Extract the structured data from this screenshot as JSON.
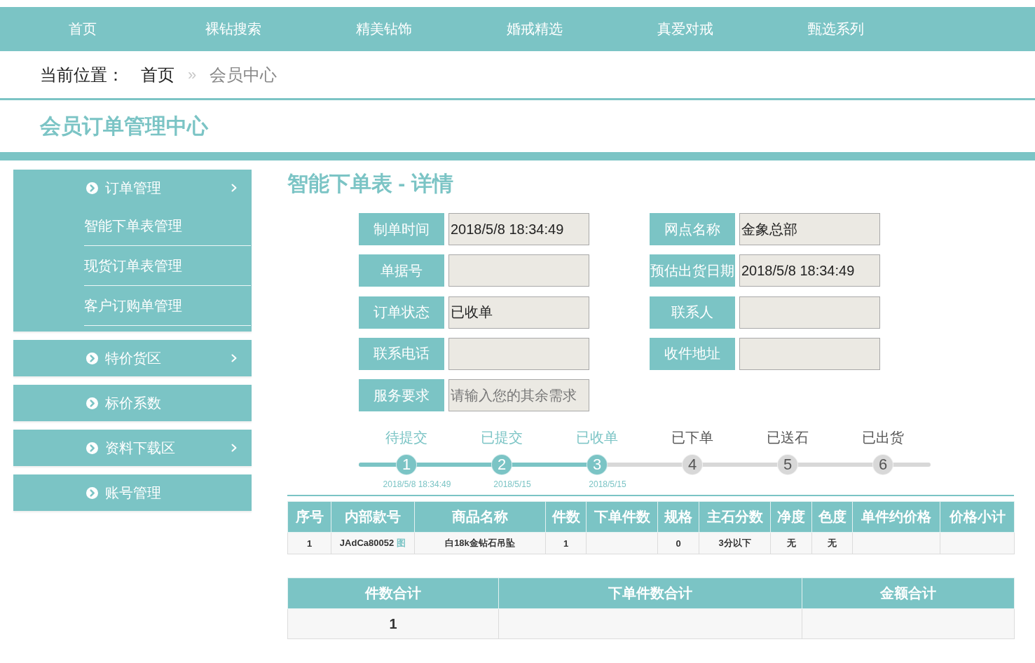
{
  "nav": {
    "items": [
      "首页",
      "裸钻搜索",
      "精美钻饰",
      "婚戒精选",
      "真爱对戒",
      "甄选系列"
    ]
  },
  "breadcrumb": {
    "prefix": "当前位置：",
    "separator": "»",
    "items": [
      {
        "label": "首页",
        "current": false
      },
      {
        "label": "会员中心",
        "current": true
      }
    ]
  },
  "page_title": "会员订单管理中心",
  "sidebar": {
    "groups": [
      {
        "label": "订单管理",
        "has_submenu": true,
        "children": [
          {
            "label": "智能下单表管理"
          },
          {
            "label": "现货订单表管理"
          },
          {
            "label": "客户订购单管理"
          }
        ]
      },
      {
        "label": "特价货区",
        "has_submenu": true
      },
      {
        "label": "标价系数",
        "has_submenu": false
      },
      {
        "label": "资料下载区",
        "has_submenu": true
      },
      {
        "label": "账号管理",
        "has_submenu": false
      }
    ]
  },
  "detail": {
    "title": "智能下单表 - 详情",
    "fields": [
      {
        "label": "制单时间",
        "value": "2018/5/8 18:34:49"
      },
      {
        "label": "网点名称",
        "value": "金象总部"
      },
      {
        "label": "单据号"
      },
      {
        "label": "预估出货日期",
        "value": "2018/5/8 18:34:49"
      },
      {
        "label": "订单状态",
        "value": "已收单"
      },
      {
        "label": "联系人"
      },
      {
        "label": "联系电话"
      },
      {
        "label": "收件地址"
      },
      {
        "label": "服务要求",
        "placeholder": "请输入您的其余需求"
      }
    ]
  },
  "progress": {
    "steps": [
      {
        "label": "待提交",
        "number": "1",
        "done": true,
        "date": "2018/5/8 18:34:49"
      },
      {
        "label": "已提交",
        "number": "2",
        "done": true,
        "date": "2018/5/15"
      },
      {
        "label": "已收单",
        "number": "3",
        "done": true,
        "date": "2018/5/15"
      },
      {
        "label": "已下单",
        "number": "4",
        "done": false
      },
      {
        "label": "已送石",
        "number": "5",
        "done": false
      },
      {
        "label": "已出货",
        "number": "6",
        "done": false
      }
    ]
  },
  "items_table": {
    "columns": [
      "序号",
      "内部款号",
      "商品名称",
      "件数",
      "下单件数",
      "规格",
      "主石分数",
      "净度",
      "色度",
      "单件约价格",
      "价格小计"
    ],
    "rows": [
      {
        "cells": [
          {
            "text": "1"
          },
          {
            "text": "JAdCa80052",
            "link": "图"
          },
          {
            "text": "白18k金钻石吊坠"
          },
          {
            "text": "1"
          },
          {},
          {
            "text": "0"
          },
          {
            "text": "3分以下"
          },
          {
            "text": "无"
          },
          {
            "text": "无"
          },
          {},
          {}
        ]
      }
    ]
  },
  "totals_table": {
    "columns": [
      {
        "label": "件数合计",
        "value": "1"
      },
      {
        "label": "下单件数合计"
      },
      {
        "label": "金额合计"
      }
    ]
  }
}
